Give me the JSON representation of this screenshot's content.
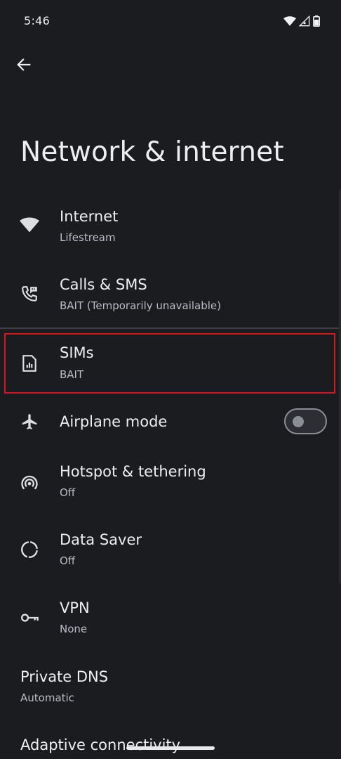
{
  "status_bar": {
    "time": "5:46",
    "icons": [
      "wifi-icon",
      "cell-signal-icon",
      "battery-icon"
    ]
  },
  "header": {
    "back_icon": "arrow-left-icon",
    "title": "Network & internet"
  },
  "items": [
    {
      "icon": "wifi-icon",
      "title": "Internet",
      "summary": "Lifestream"
    },
    {
      "icon": "phone-sms-icon",
      "title": "Calls & SMS",
      "summary": "BAIT (Temporarily unavailable)"
    },
    {
      "icon": "sim-card-icon",
      "title": "SIMs",
      "summary": "BAIT",
      "highlighted": true
    },
    {
      "icon": "airplane-icon",
      "title": "Airplane mode",
      "toggle": false
    },
    {
      "icon": "hotspot-icon",
      "title": "Hotspot & tethering",
      "summary": "Off"
    },
    {
      "icon": "data-saver-icon",
      "title": "Data Saver",
      "summary": "Off"
    },
    {
      "icon": "vpn-key-icon",
      "title": "VPN",
      "summary": "None"
    },
    {
      "title": "Private DNS",
      "summary": "Automatic"
    },
    {
      "title": "Adaptive connectivity"
    }
  ],
  "colors": {
    "background": "#1b1c1f",
    "highlight": "#d11a1f",
    "text_primary": "#eceef0",
    "text_secondary": "#b9bcc1"
  }
}
